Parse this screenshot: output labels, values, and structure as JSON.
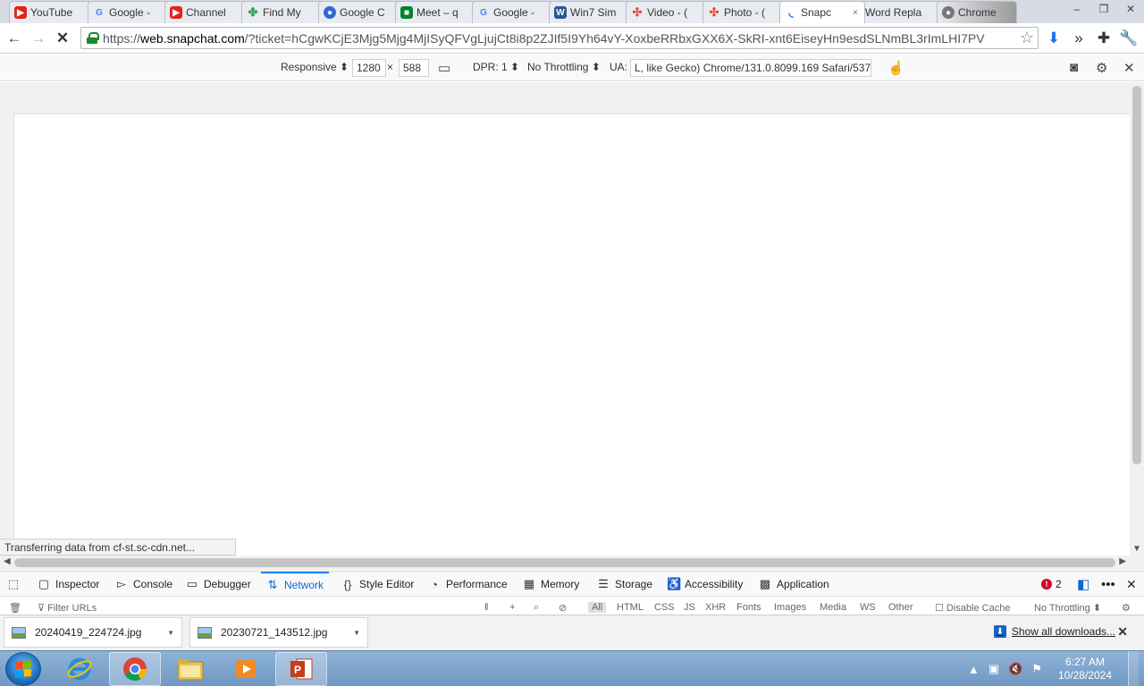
{
  "browser": {
    "tabs": [
      {
        "title": "YouTube",
        "icon": "youtube-icon",
        "color": "#e62117"
      },
      {
        "title": "Google -",
        "icon": "google-icon",
        "color": "#4285f4"
      },
      {
        "title": "Channel",
        "icon": "youtube-icon",
        "color": "#e62117"
      },
      {
        "title": "Find My",
        "icon": "pinwheel-icon",
        "color": "#34a853"
      },
      {
        "title": "Google C",
        "icon": "contacts-icon",
        "color": "#3367d6"
      },
      {
        "title": "Meet – q",
        "icon": "meet-icon",
        "color": "#00832d"
      },
      {
        "title": "Google -",
        "icon": "google-icon",
        "color": "#4285f4"
      },
      {
        "title": "Win7 Sim",
        "icon": "win7sim-icon",
        "color": "#2b5797"
      },
      {
        "title": "Video - (",
        "icon": "photos-icon",
        "color": "#fbbc05"
      },
      {
        "title": "Photo - (",
        "icon": "photos-icon",
        "color": "#fbbc05"
      },
      {
        "title": "Snapc",
        "icon": "loading-icon",
        "color": "#1a73e8",
        "active": true,
        "close": "×"
      },
      {
        "title": "Word Repla",
        "icon": "",
        "color": "#ffffff"
      },
      {
        "title": "Chrome",
        "icon": "chrome-theme-icon",
        "color": "#888888"
      }
    ],
    "window_controls": {
      "minimize": "–",
      "restore": "❐",
      "close": "✕"
    },
    "url_scheme": "https://",
    "url_host": "web.snapchat.com",
    "url_rest": "/?ticket=hCgwKCjE3Mjg5Mjg4MjISyQFVgLjujCt8i8p2ZJIf5I9Yh64vY-XoxbeRRbxGXX6X-SkRI-xnt6EiseyHn9esdSLNmBL3rImLHI7PV"
  },
  "rdm": {
    "device": "Responsive ⬍",
    "width": "1280",
    "times": "×",
    "height": "588",
    "dpr": "DPR: 1 ⬍",
    "throttle": "No Throttling ⬍",
    "ua_label": "UA:",
    "ua_value": "L, like Gecko) Chrome/131.0.8099.169 Safari/537.36"
  },
  "status": "Transferring data from cf-st.sc-cdn.net...",
  "devtools": {
    "tabs": [
      "Inspector",
      "Console",
      "Debugger",
      "Network",
      "Style Editor",
      "Performance",
      "Memory",
      "Storage",
      "Accessibility",
      "Application"
    ],
    "active_tab": "Network",
    "error_count": "2",
    "filter_placeholder": "Filter URLs",
    "filter_types": [
      "All",
      "HTML",
      "CSS",
      "JS",
      "XHR",
      "Fonts",
      "Images",
      "Media",
      "WS",
      "Other"
    ],
    "disable_cache": "Disable Cache",
    "throttle": "No Throttling ⬍"
  },
  "downloads": {
    "items": [
      "20240419_224724.jpg",
      "20230721_143512.jpg"
    ],
    "show_all": "Show all downloads..."
  },
  "taskbar": {
    "time": "6:27 AM",
    "date": "10/28/2024"
  }
}
